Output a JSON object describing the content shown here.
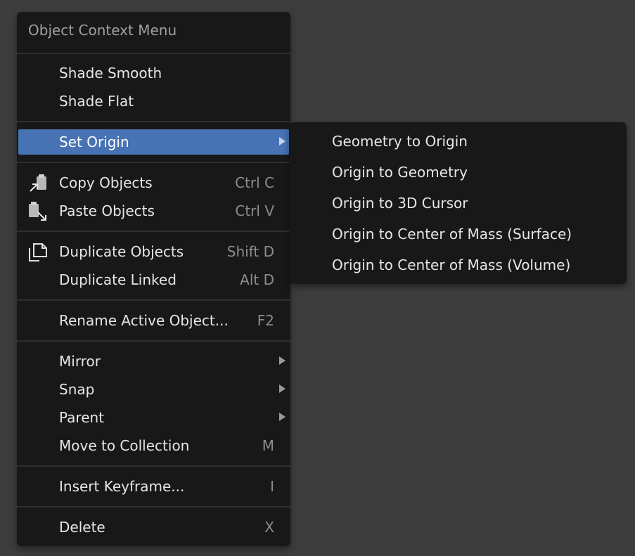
{
  "menu": {
    "title": "Object Context Menu",
    "items": [
      {
        "label": "Shade Smooth"
      },
      {
        "label": "Shade Flat"
      },
      {
        "label": "Set Origin",
        "submenu": true
      },
      {
        "label": "Copy Objects",
        "shortcut": "Ctrl C",
        "icon": "copy-icon"
      },
      {
        "label": "Paste Objects",
        "shortcut": "Ctrl V",
        "icon": "paste-icon"
      },
      {
        "label": "Duplicate Objects",
        "shortcut": "Shift D",
        "icon": "duplicate-icon"
      },
      {
        "label": "Duplicate Linked",
        "shortcut": "Alt D"
      },
      {
        "label": "Rename Active Object...",
        "shortcut": "F2"
      },
      {
        "label": "Mirror",
        "submenu": true
      },
      {
        "label": "Snap",
        "submenu": true
      },
      {
        "label": "Parent",
        "submenu": true
      },
      {
        "label": "Move to Collection",
        "shortcut": "M"
      },
      {
        "label": "Insert Keyframe...",
        "shortcut": "I"
      },
      {
        "label": "Delete",
        "shortcut": "X"
      }
    ]
  },
  "submenu": {
    "items": [
      {
        "label": "Geometry to Origin"
      },
      {
        "label": "Origin to Geometry"
      },
      {
        "label": "Origin to 3D Cursor"
      },
      {
        "label": "Origin to Center of Mass (Surface)"
      },
      {
        "label": "Origin to Center of Mass (Volume)"
      }
    ]
  },
  "colors": {
    "background": "#3d3d3d",
    "menu_bg": "#181818",
    "highlight": "#4772b3",
    "text": "#e6e6e6",
    "shortcut_text": "#8c8c8c"
  }
}
